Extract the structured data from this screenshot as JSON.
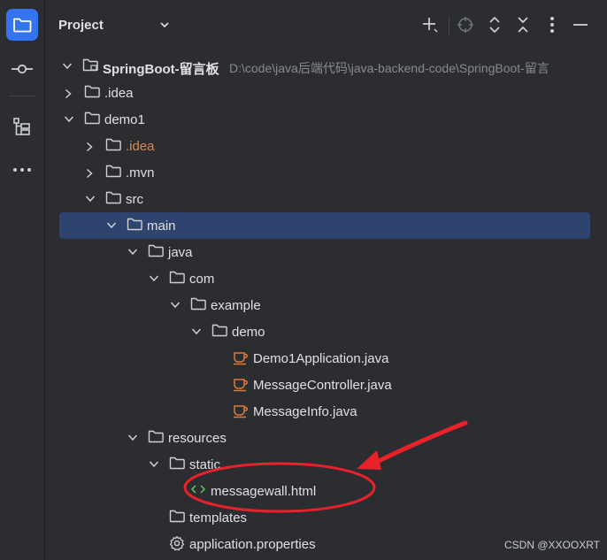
{
  "panel": {
    "title": "Project"
  },
  "activity_bar": {
    "items": [
      {
        "icon": "folder-icon",
        "active": true
      },
      {
        "icon": "commit-icon",
        "active": false
      },
      {
        "icon": "structure-icon",
        "active": false
      },
      {
        "icon": "more-icon",
        "active": false
      }
    ]
  },
  "toolbar": {
    "icons": [
      "add-icon",
      "locate-icon",
      "expand-all-icon",
      "collapse-all-icon",
      "options-icon",
      "hide-icon"
    ]
  },
  "tree": {
    "root": {
      "label": "SpringBoot-留言板",
      "path": "D:\\code\\java后端代码\\java-backend-code\\SpringBoot-留言"
    },
    "rows": [
      {
        "label": ".idea",
        "type": "folder"
      },
      {
        "label": "demo1",
        "type": "folder"
      },
      {
        "label": ".idea",
        "type": "folder"
      },
      {
        "label": ".mvn",
        "type": "folder"
      },
      {
        "label": "src",
        "type": "folder"
      },
      {
        "label": "main",
        "type": "folder"
      },
      {
        "label": "java",
        "type": "folder"
      },
      {
        "label": "com",
        "type": "folder"
      },
      {
        "label": "example",
        "type": "folder"
      },
      {
        "label": "demo",
        "type": "folder"
      },
      {
        "label": "Demo1Application.java",
        "type": "java"
      },
      {
        "label": "MessageController.java",
        "type": "java"
      },
      {
        "label": "MessageInfo.java",
        "type": "java"
      },
      {
        "label": "resources",
        "type": "folder"
      },
      {
        "label": "static",
        "type": "folder"
      },
      {
        "label": "messagewall.html",
        "type": "html"
      },
      {
        "label": "templates",
        "type": "folder"
      },
      {
        "label": "application.properties",
        "type": "settings"
      }
    ]
  },
  "colors": {
    "accent": "#3574f0",
    "selection": "#2e436e",
    "annotation": "#e8212b",
    "java_icon": "#e07a3a",
    "html_icon": "#5fb85f",
    "orange_label": "#d98b55"
  },
  "watermark": "CSDN @XXOOXRT"
}
